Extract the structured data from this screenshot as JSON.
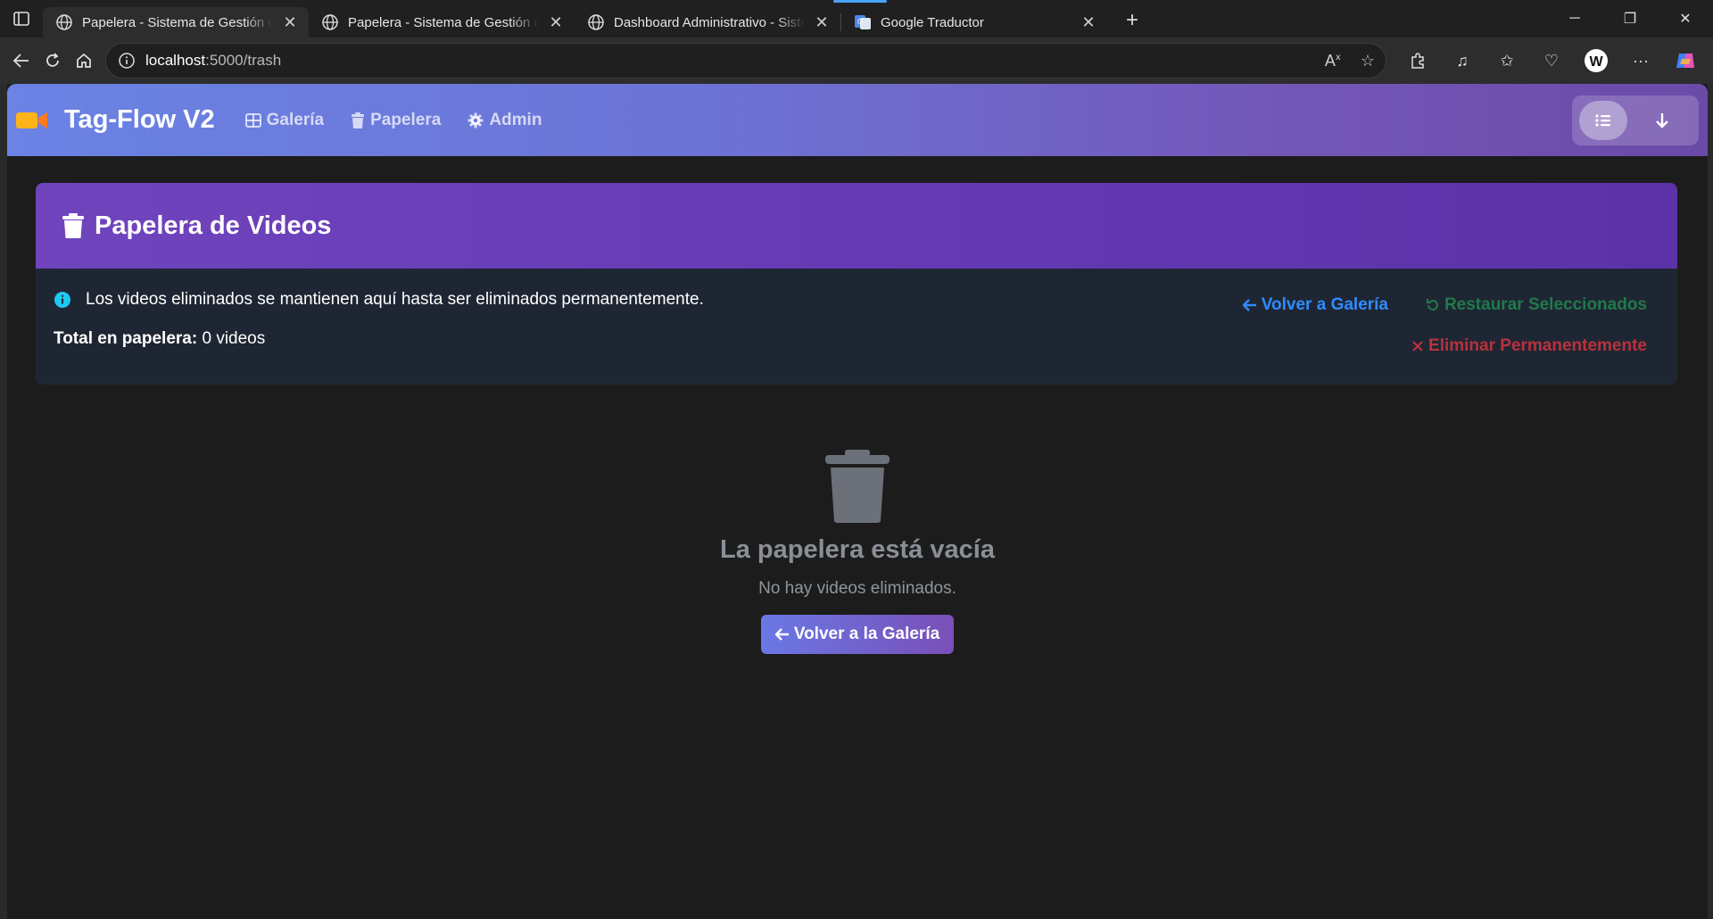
{
  "browser": {
    "tabs": [
      {
        "title": "Papelera - Sistema de Gestión de Videos",
        "active": true
      },
      {
        "title": "Papelera - Sistema de Gestión de Videos",
        "active": false
      },
      {
        "title": "Dashboard Administrativo - Sistema",
        "active": false
      },
      {
        "title": "Google Traductor",
        "active": false
      }
    ],
    "url_host": "localhost",
    "url_rest": ":5000/trash"
  },
  "navbar": {
    "brand": "Tag-Flow V2",
    "links": [
      "Galería",
      "Papelera",
      "Admin"
    ]
  },
  "card": {
    "title": "Papelera de Videos",
    "info": "Los videos eliminados se mantienen aquí hasta ser eliminados permanentemente.",
    "total_label": "Total en papelera:",
    "total_value": "0 videos",
    "actions": {
      "back": "Volver a Galería",
      "restore": "Restaurar Seleccionados",
      "delete": "Eliminar Permanentemente"
    }
  },
  "empty": {
    "title": "La papelera está vacía",
    "subtitle": "No hay videos eliminados.",
    "button": "Volver a la Galería"
  },
  "colors": {
    "link_blue": "#2f8cff",
    "restore_green": "#1f7a4a",
    "delete_red": "#b8323e",
    "header_purple": "#6438b2"
  }
}
